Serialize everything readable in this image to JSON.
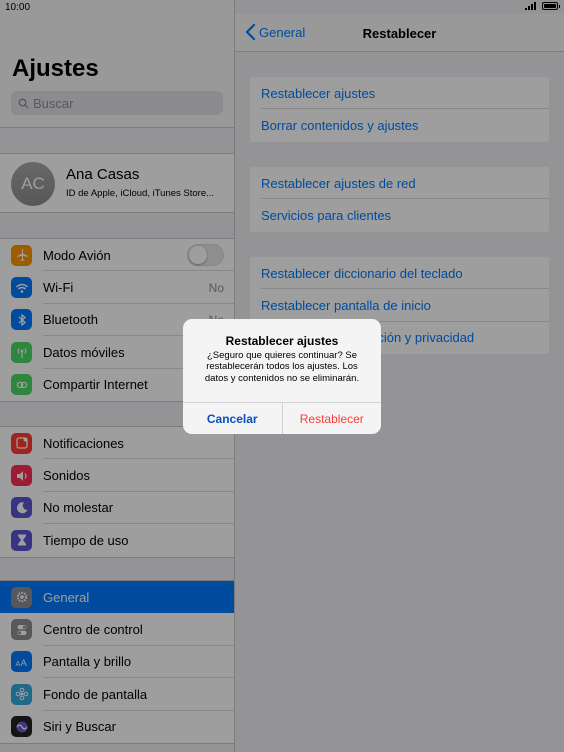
{
  "status_bar": {
    "time": "10:00"
  },
  "sidebar": {
    "title": "Ajustes",
    "search_placeholder": "Buscar",
    "profile": {
      "initials": "AC",
      "name": "Ana Casas",
      "subtitle": "ID de Apple, iCloud, iTunes Store..."
    },
    "groups": [
      [
        {
          "label": "Modo Avión",
          "icon": "airplane-icon",
          "color": "#ff9500",
          "toggle": "off"
        },
        {
          "label": "Wi-Fi",
          "icon": "wifi-icon",
          "color": "#007aff",
          "value": "No"
        },
        {
          "label": "Bluetooth",
          "icon": "bluetooth-icon",
          "color": "#007aff",
          "value": "No"
        },
        {
          "label": "Datos móviles",
          "icon": "antenna-icon",
          "color": "#4cd964"
        },
        {
          "label": "Compartir Internet",
          "icon": "chain-icon",
          "color": "#4cd964"
        }
      ],
      [
        {
          "label": "Notificaciones",
          "icon": "notifications-icon",
          "color": "#ff3b30"
        },
        {
          "label": "Sonidos",
          "icon": "speaker-icon",
          "color": "#ff2d55"
        },
        {
          "label": "No molestar",
          "icon": "moon-icon",
          "color": "#5856d6"
        },
        {
          "label": "Tiempo de uso",
          "icon": "hourglass-icon",
          "color": "#5856d6"
        }
      ],
      [
        {
          "label": "General",
          "icon": "gear-icon",
          "color": "#8e8e93",
          "selected": true
        },
        {
          "label": "Centro de control",
          "icon": "switches-icon",
          "color": "#8e8e93"
        },
        {
          "label": "Pantalla y brillo",
          "icon": "text-size-icon",
          "color": "#007aff",
          "glyph": "AA"
        },
        {
          "label": "Fondo de pantalla",
          "icon": "flower-icon",
          "color": "#34aadc"
        },
        {
          "label": "Siri y Buscar",
          "icon": "siri-icon",
          "color": "#222222"
        }
      ]
    ]
  },
  "detail": {
    "back_label": "General",
    "title": "Restablecer",
    "groups": [
      [
        "Restablecer ajustes",
        "Borrar contenidos y ajustes"
      ],
      [
        "Restablecer ajustes de red",
        "Servicios para clientes"
      ],
      [
        "Restablecer diccionario del teclado",
        "Restablecer pantalla de inicio",
        "Restablecer localización y privacidad"
      ]
    ]
  },
  "alert": {
    "title": "Restablecer ajustes",
    "message": "¿Seguro que quieres continuar? Se restablecerán todos los ajustes. Los datos y contenidos no se eliminarán.",
    "cancel_label": "Cancelar",
    "confirm_label": "Restablecer"
  }
}
